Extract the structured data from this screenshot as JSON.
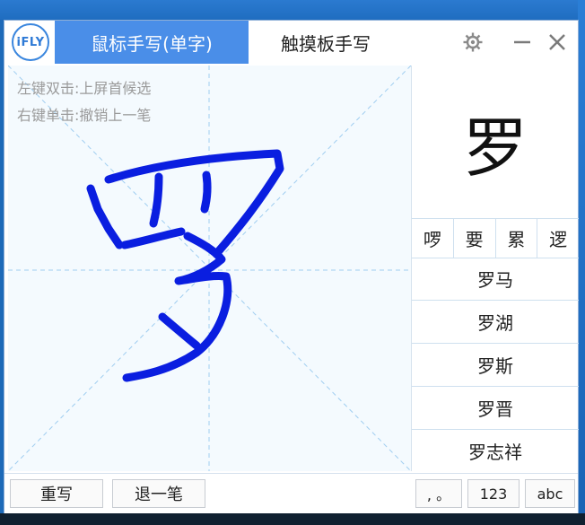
{
  "app": {
    "logo_text": "iFLY",
    "tabs": [
      {
        "label": "鼠标手写(单字)",
        "active": true
      },
      {
        "label": "触摸板手写",
        "active": false
      }
    ],
    "icons": {
      "settings": "gear-icon",
      "minimize": "minimize-icon",
      "close": "close-icon"
    },
    "accent": "#4a8ee8"
  },
  "canvas": {
    "hints": [
      "左键双击:上屏首候选",
      "右键单击:撤销上一笔"
    ],
    "ink_color": "#0a1ee0"
  },
  "candidates": {
    "preview_char": "罗",
    "single": [
      "啰",
      "要",
      "累",
      "逻"
    ],
    "phrases": [
      "罗马",
      "罗湖",
      "罗斯",
      "罗晋",
      "罗志祥"
    ]
  },
  "bottom": {
    "rewrite": "重写",
    "undo": "退一笔",
    "punct": ", 。",
    "num": "123",
    "abc": "abc"
  }
}
